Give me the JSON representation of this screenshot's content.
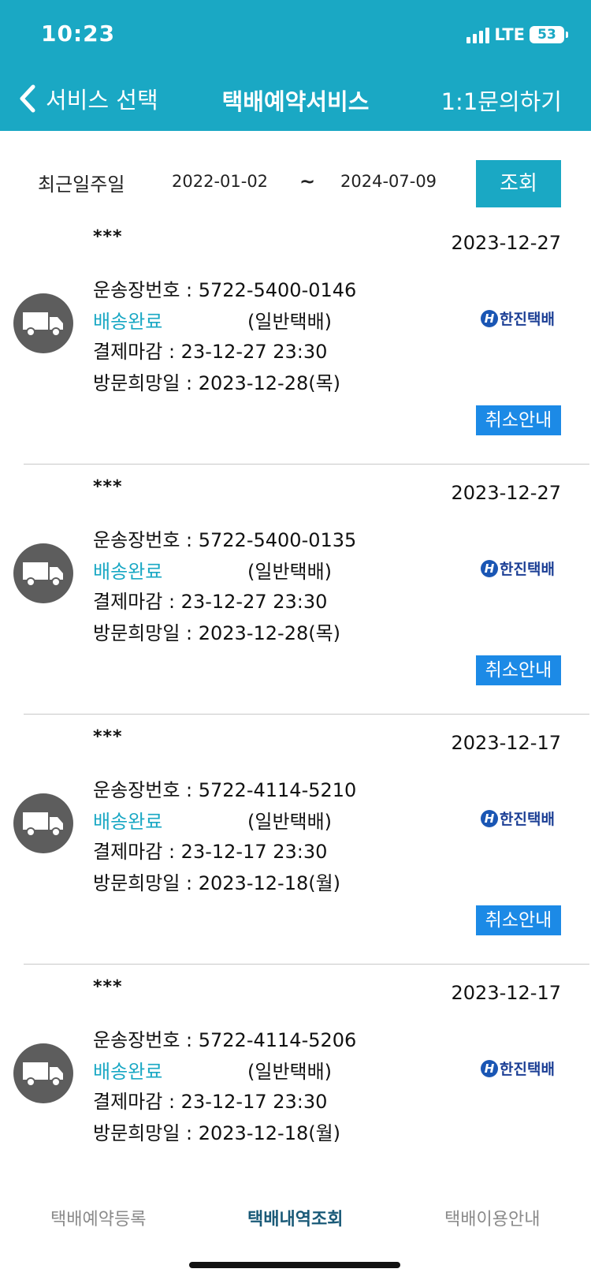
{
  "status_bar": {
    "time": "10:23",
    "network": "LTE",
    "battery": "53"
  },
  "nav": {
    "back_label": "서비스 선택",
    "title": "택배예약서비스",
    "inquiry": "1:1문의하기"
  },
  "filter": {
    "label": "최근일주일",
    "date_from": "2022-01-02",
    "separator": "~",
    "date_to": "2024-07-09",
    "search_button": "조회"
  },
  "labels": {
    "tracking": "운송장번호 : ",
    "payment_deadline": "결제마감 : ",
    "visit_date": "방문희망일 : "
  },
  "orders": [
    {
      "recipient": "***",
      "date": "2023-12-27",
      "tracking_no": "5722-5400-0146",
      "status": "배송완료",
      "type": "(일반택배)",
      "carrier": "한진택배",
      "payment_deadline": "23-12-27 23:30",
      "visit_date": "2023-12-28(목)",
      "cancel_button": "취소안내"
    },
    {
      "recipient": "***",
      "date": "2023-12-27",
      "tracking_no": "5722-5400-0135",
      "status": "배송완료",
      "type": "(일반택배)",
      "carrier": "한진택배",
      "payment_deadline": "23-12-27 23:30",
      "visit_date": "2023-12-28(목)",
      "cancel_button": "취소안내"
    },
    {
      "recipient": "***",
      "date": "2023-12-17",
      "tracking_no": "5722-4114-5210",
      "status": "배송완료",
      "type": "(일반택배)",
      "carrier": "한진택배",
      "payment_deadline": "23-12-17 23:30",
      "visit_date": "2023-12-18(월)",
      "cancel_button": "취소안내"
    },
    {
      "recipient": "***",
      "date": "2023-12-17",
      "tracking_no": "5722-4114-5206",
      "status": "배송완료",
      "type": "(일반택배)",
      "carrier": "한진택배",
      "payment_deadline": "23-12-17 23:30",
      "visit_date": "2023-12-18(월)"
    }
  ],
  "tabs": [
    {
      "label": "택배예약등록",
      "active": false
    },
    {
      "label": "택배내역조회",
      "active": true
    },
    {
      "label": "택배이용안내",
      "active": false
    }
  ],
  "colors": {
    "brand": "#1aa8c4",
    "cancel": "#1c8ae6",
    "carrier": "#1c3f95"
  }
}
